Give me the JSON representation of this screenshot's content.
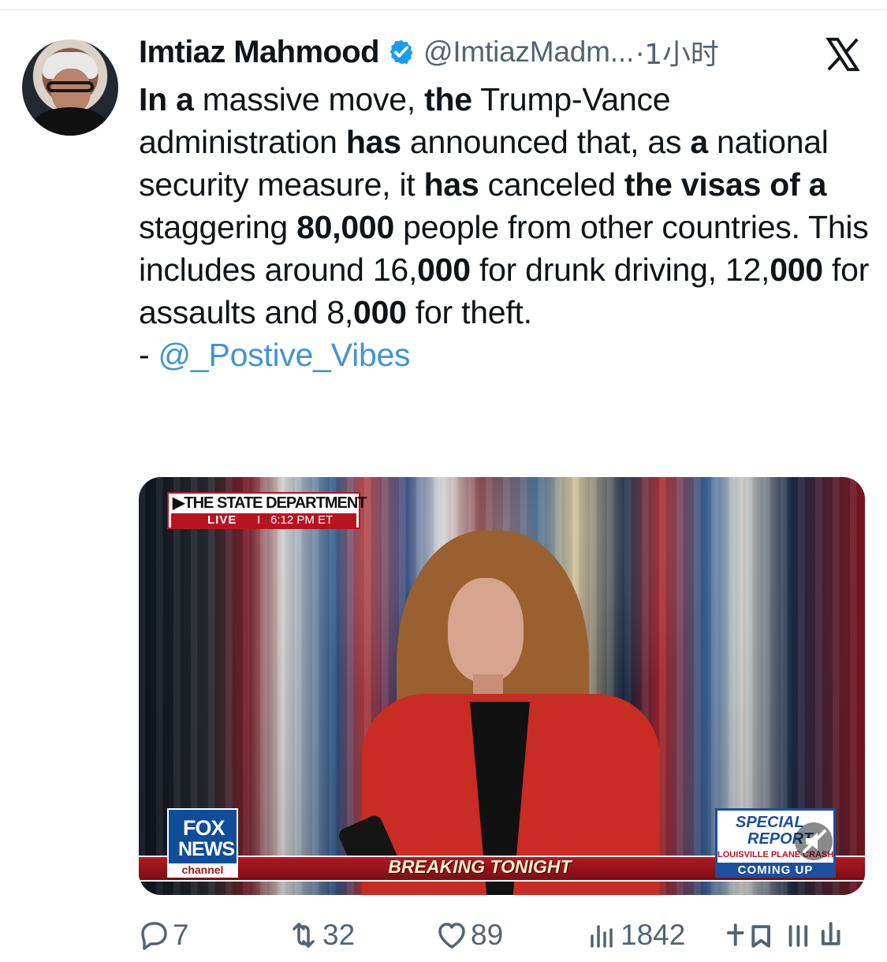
{
  "tweet": {
    "author": {
      "name": "Imtiaz Mahmood",
      "handle": "@ImtiazMadm...",
      "timestamp": "1小时",
      "verified_icon": "verified-badge-icon",
      "avatar_icon": "user-avatar"
    },
    "brand_icon": "x-logo-icon",
    "paragraph": [
      {
        "text": "In a",
        "bold": true
      },
      {
        "text": " massive move, ",
        "bold": false
      },
      {
        "text": "the",
        "bold": true
      },
      {
        "text": " Trump-Vance administration ",
        "bold": false
      },
      {
        "text": "has",
        "bold": true
      },
      {
        "text": " announced that, as ",
        "bold": false
      },
      {
        "text": "a",
        "bold": true
      },
      {
        "text": " national security measure, it ",
        "bold": false
      },
      {
        "text": "has",
        "bold": true
      },
      {
        "text": " canceled ",
        "bold": false
      },
      {
        "text": "the visas of a",
        "bold": true
      },
      {
        "text": " staggering ",
        "bold": false
      },
      {
        "text": "80,000",
        "bold": true
      },
      {
        "text": " people from other countries. This includes around 16,",
        "bold": false
      },
      {
        "text": "000",
        "bold": true
      },
      {
        "text": " for drunk driving, 12,",
        "bold": false
      },
      {
        "text": "000",
        "bold": true
      },
      {
        "text": " for assaults and 8,",
        "bold": false
      },
      {
        "text": "000",
        "bold": true
      },
      {
        "text": " for theft.",
        "bold": false
      }
    ],
    "credit_prefix": "- ",
    "credit_mention": "@_Postive_Vibes"
  },
  "media": {
    "state_title": "▶THE STATE DEPARTMENT",
    "live": "LIVE",
    "separator": "I",
    "time": "6:12 PM ET",
    "fox": "FOX",
    "news": "NEWS",
    "channel": "channel",
    "breaking": "BREAKING TONIGHT",
    "special_top": "SPECIAL",
    "special_bottom": "REPORT",
    "crash": "LOUISVILLE PLANE CRASH",
    "coming_up": "COMING UP",
    "mute_icon": "muted-speaker-icon"
  },
  "actions": {
    "replies": "7",
    "reposts": "32",
    "likes": "89",
    "views": "1842"
  },
  "colors": {
    "text": "#0f1419",
    "muted": "#536471",
    "link": "#4193d7",
    "verified": "#1d9bf0",
    "fox_blue": "#0f4d9a",
    "fox_red": "#b81420"
  }
}
